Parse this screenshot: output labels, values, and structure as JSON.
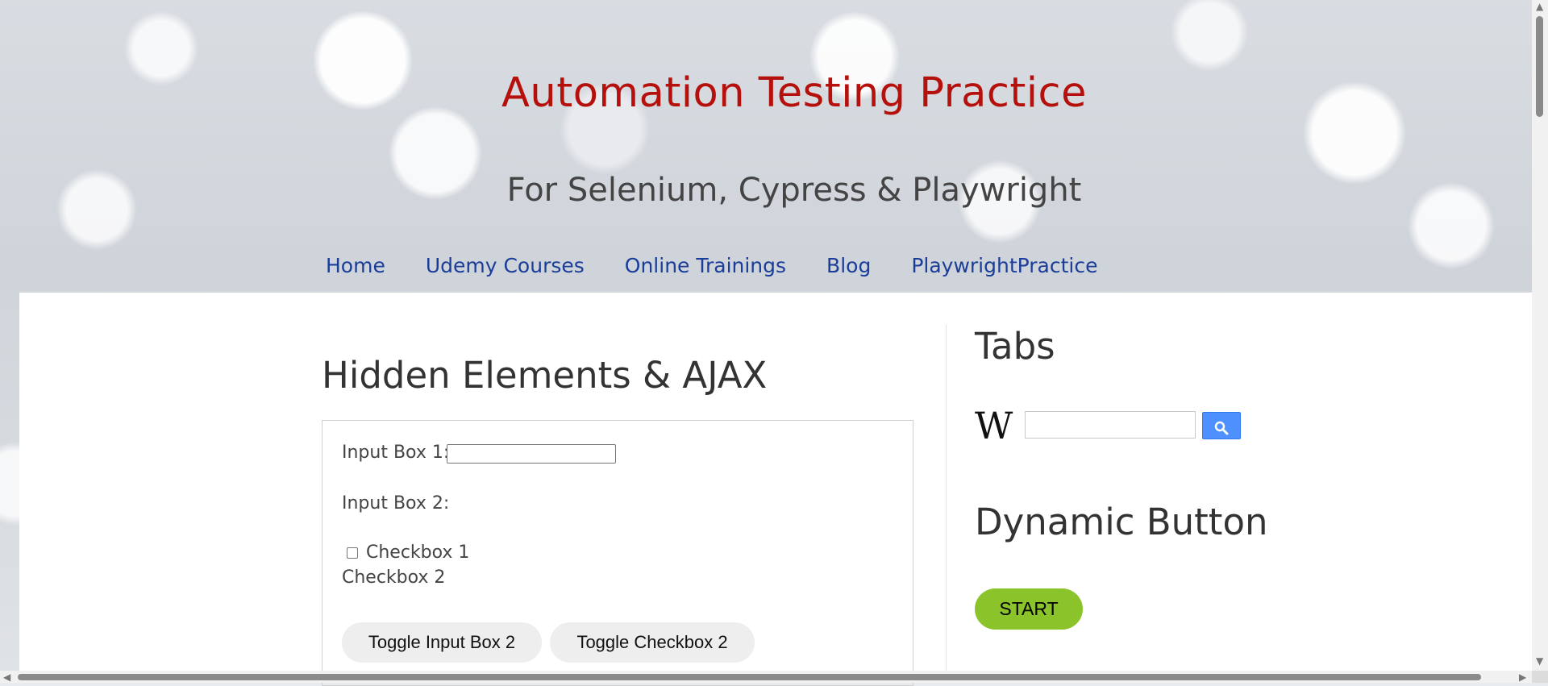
{
  "header": {
    "title": "Automation Testing Practice",
    "tagline": "For Selenium, Cypress & Playwright",
    "nav": [
      {
        "label": "Home"
      },
      {
        "label": "Udemy Courses"
      },
      {
        "label": "Online Trainings"
      },
      {
        "label": "Blog"
      },
      {
        "label": "PlaywrightPractice"
      }
    ]
  },
  "main": {
    "heading": "Hidden Elements & AJAX",
    "input_box_1_label": "Input Box 1:",
    "input_box_2_label": "Input Box 2:",
    "checkbox_1_label": "Checkbox 1",
    "checkbox_2_label": "Checkbox 2",
    "toggle_input_label": "Toggle Input Box 2",
    "toggle_checkbox_label": "Toggle Checkbox 2"
  },
  "sidebar": {
    "tabs_heading": "Tabs",
    "wiki_logo_text": "W",
    "dynamic_heading": "Dynamic Button",
    "start_label": "START"
  },
  "colors": {
    "title": "#b5100b",
    "nav_link": "#1a3d9a",
    "start_button": "#8bc42a",
    "search_button": "#4d90fe"
  },
  "icons": [
    "wikipedia-logo-icon",
    "search-icon"
  ]
}
